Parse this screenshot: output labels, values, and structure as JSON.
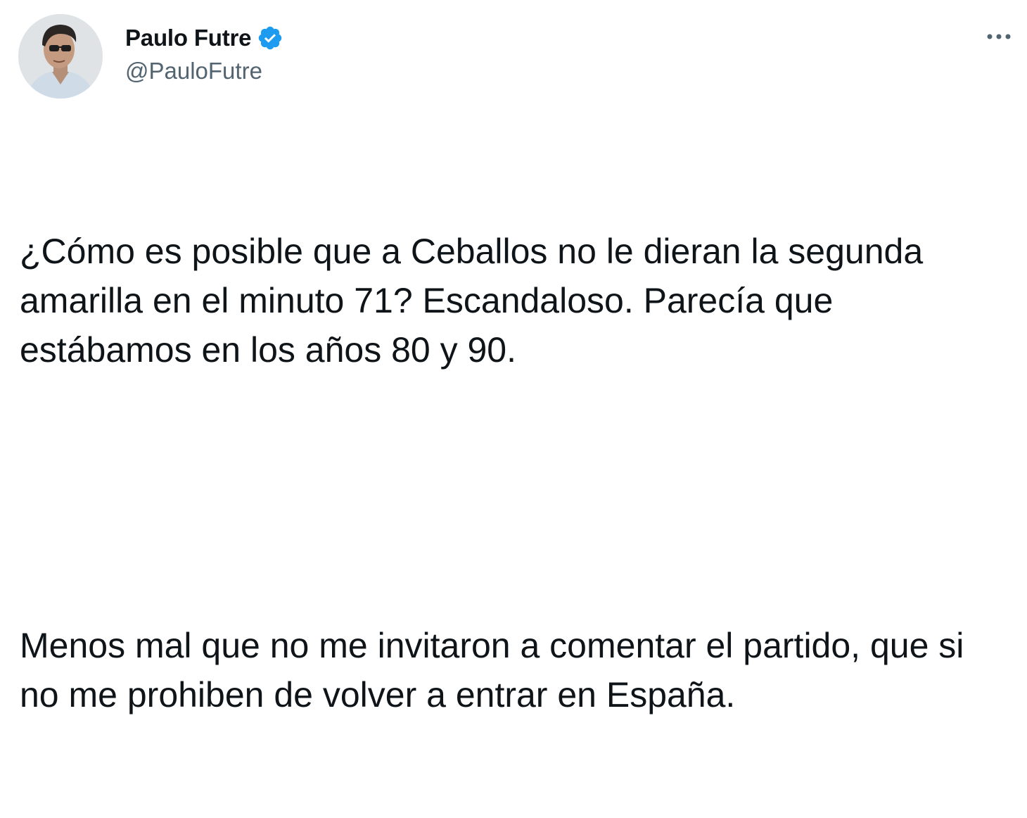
{
  "author": {
    "display_name": "Paulo Futre",
    "handle": "@PauloFutre",
    "verified": true,
    "verified_color": "#1d9bf0"
  },
  "menu": {
    "icon": "more-horizontal-icon"
  },
  "tweet": {
    "paragraphs": [
      "¿Cómo es posible que a Ceballos no le dieran la segunda amarilla en el minuto 71? Escandaloso. Parecía que estábamos en los años 80 y 90.",
      "Menos mal que no me invitaron a comentar el partido, que si no me prohiben de volver a entrar en España."
    ]
  }
}
